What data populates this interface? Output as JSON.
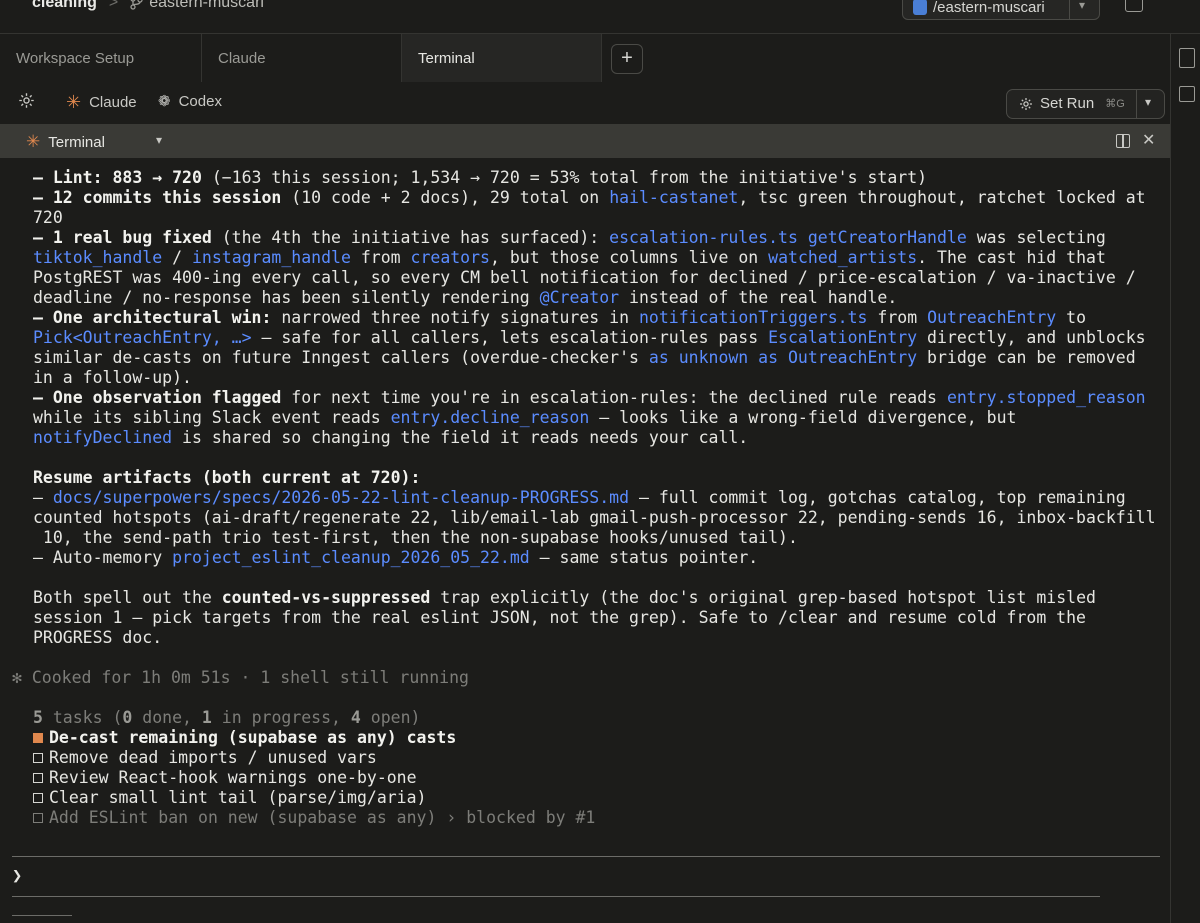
{
  "header": {
    "repo": "cleaning",
    "separator": ">",
    "branch": "eastern-muscari",
    "workspace": "/eastern-muscari"
  },
  "tabs": [
    {
      "label": "Workspace Setup"
    },
    {
      "label": "Claude"
    },
    {
      "label": "Terminal"
    }
  ],
  "add_tab": "+",
  "toolbar": {
    "claude": "Claude",
    "codex": "Codex",
    "set_run": "Set Run",
    "set_run_shortcut": "⌘G"
  },
  "terminal_header": {
    "title": "Terminal"
  },
  "terminal": {
    "l1a": "– Lint: 883 → 720",
    "l1b": " (−163 this session; 1,534 → 720 = 53% total from the initiative's start)",
    "l2a": "– 12 commits this session",
    "l2b": " (10 code + 2 docs), 29 total on ",
    "l2c": "hail-castanet",
    "l2d": ", tsc green throughout, ratchet locked at",
    "l3": "720",
    "l4a": "– 1 real bug fixed",
    "l4b": " (the 4th the initiative has surfaced): ",
    "l4c": "escalation-rules.ts getCreatorHandle",
    "l4d": " was selecting",
    "l5a": "tiktok_handle",
    "l5b": " / ",
    "l5c": "instagram_handle",
    "l5d": " from ",
    "l5e": "creators",
    "l5f": ", but those columns live on ",
    "l5g": "watched_artists",
    "l5h": ". The cast hid that",
    "l6": "PostgREST was 400-ing every call, so every CM bell notification for declined / price-escalation / va-inactive /",
    "l7a": "deadline / no-response has been silently rendering ",
    "l7b": "@Creator",
    "l7c": " instead of the real handle.",
    "l8a": "– One architectural win:",
    "l8b": " narrowed three notify signatures in ",
    "l8c": "notificationTriggers.ts",
    "l8d": " from ",
    "l8e": "OutreachEntry",
    "l8f": " to",
    "l9a": "Pick<OutreachEntry, …>",
    "l9b": " – safe for all callers, lets escalation-rules pass ",
    "l9c": "EscalationEntry",
    "l9d": " directly, and unblocks",
    "l10a": "similar de-casts on future Inngest callers (overdue-checker's ",
    "l10b": "as unknown as OutreachEntry",
    "l10c": " bridge can be removed",
    "l11": "in a follow-up).",
    "l12a": "– One observation flagged",
    "l12b": " for next time you're in escalation-rules: the declined rule reads ",
    "l12c": "entry.stopped_reason",
    "l13a": "while its sibling Slack event reads ",
    "l13b": "entry.decline_reason",
    "l13c": " – looks like a wrong-field divergence, but",
    "l14a": "notifyDeclined",
    "l14b": " is shared so changing the field it reads needs your call.",
    "l15": "Resume artifacts (both current at 720):",
    "l16a": "– ",
    "l16b": "docs/superpowers/specs/2026-05-22-lint-cleanup-PROGRESS.md",
    "l16c": " – full commit log, gotchas catalog, top remaining",
    "l17": "counted hotspots (ai-draft/regenerate 22, lib/email-lab gmail-push-processor 22, pending-sends 16, inbox-backfill",
    "l18": " 10, the send-path trio test-first, then the non-supabase hooks/unused tail).",
    "l19a": "– Auto-memory ",
    "l19b": "project_eslint_cleanup_2026_05_22.md",
    "l19c": " – same status pointer.",
    "l20a": "Both spell out the ",
    "l20b": "counted-vs-suppressed",
    "l20c": " trap explicitly (the doc's original grep-based hotspot list misled",
    "l21": "session 1 – pick targets from the real eslint JSON, not the grep). Safe to /clear and resume cold from the",
    "l22": "PROGRESS doc.",
    "cooked": "Cooked for 1h 0m 51s · 1 shell still running",
    "tasks_a": "5",
    "tasks_b": " tasks (",
    "tasks_c": "0",
    "tasks_d": " done, ",
    "tasks_e": "1",
    "tasks_f": " in progress, ",
    "tasks_g": "4",
    "tasks_h": " open)",
    "task1": "De-cast remaining (supabase as any) casts",
    "task2": "Remove dead imports / unused vars",
    "task3": "Review React-hook warnings one-by-one",
    "task4": "Clear small lint tail (parse/img/aria)",
    "task5": "Add ESLint ban on new (supabase as any) › blocked by #1",
    "prompt": "❯",
    "spinner": "✻"
  }
}
